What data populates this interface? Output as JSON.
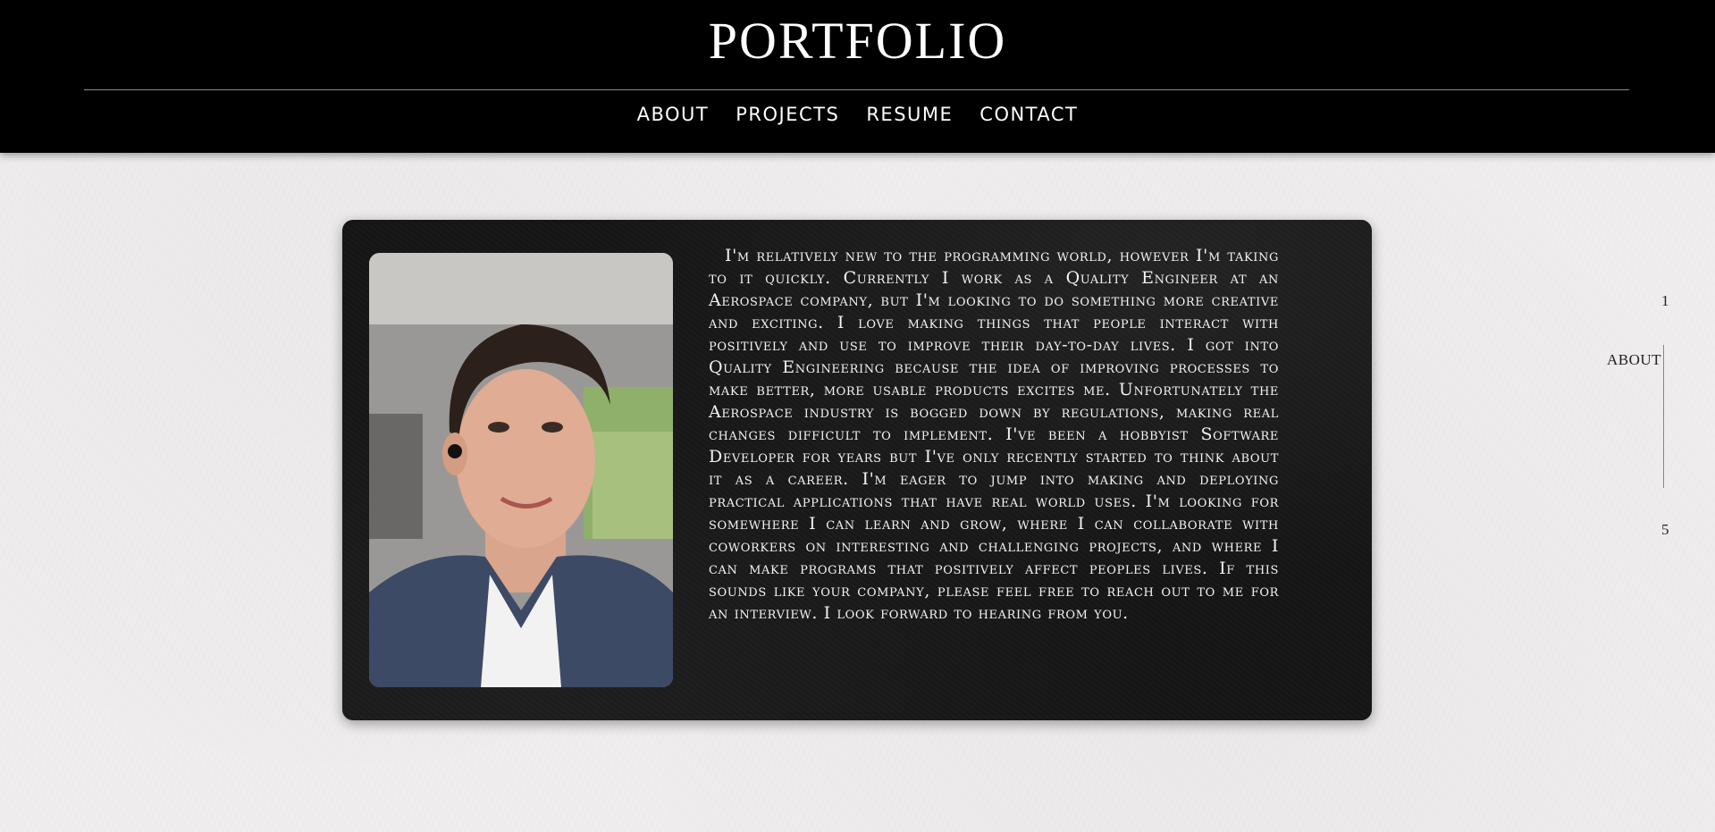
{
  "header": {
    "title": "PORTFOLIO",
    "nav": [
      {
        "label": "ABOUT"
      },
      {
        "label": "PROJECTS"
      },
      {
        "label": "RESUME"
      },
      {
        "label": "CONTACT"
      }
    ]
  },
  "about": {
    "portrait_alt": "portrait photo",
    "text": "I'm relatively new to the programming world, however I'm taking to it quickly. Currently I work as a Quality Engineer at an Aerospace company, but I'm looking to do something more creative and exciting. I love making things that people interact with positively and use to improve their day-to-day lives. I got into Quality Engineering because the idea of improving processes to make better, more usable products excites me. Unfortunately the Aerospace industry is bogged down by regulations, making real changes difficult to implement. I've been a hobbyist Software Developer for years but I've only recently started to think about it as a career. I'm eager to jump into making and deploying practical applications that have real world uses. I'm looking for somewhere I can learn and grow, where I can collaborate with coworkers on interesting and challenging projects, and where I can make programs that positively affect peoples lives. If this sounds like your company, please feel free to reach out to me for an interview. I look forward to hearing from you."
  },
  "side_index": {
    "start": "1",
    "current_label": "ABOUT",
    "end": "5"
  },
  "colors": {
    "header_bg": "#000000",
    "page_bg": "#efeded",
    "card_bg": "#151515",
    "text_light": "#ffffff"
  }
}
